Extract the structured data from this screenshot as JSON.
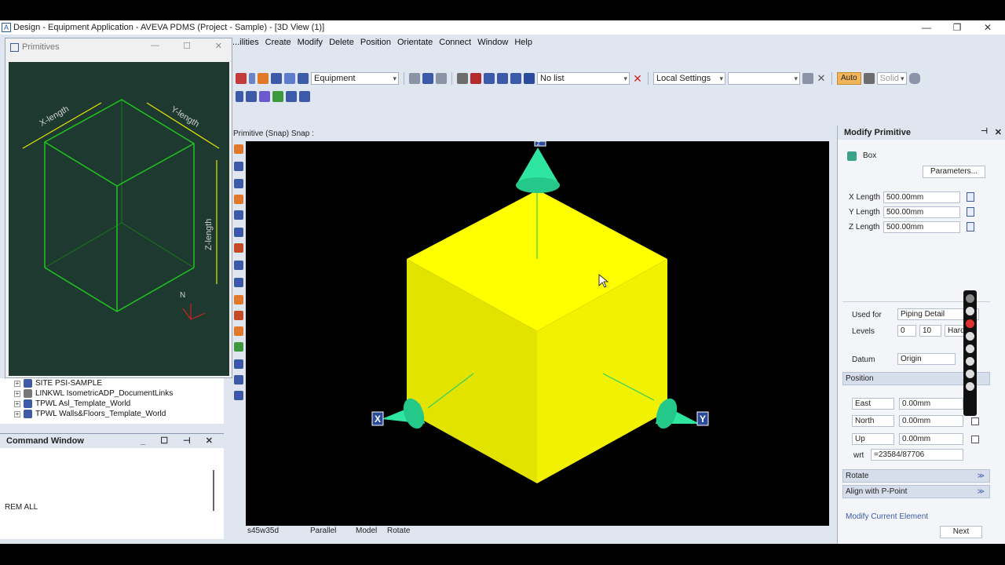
{
  "window": {
    "title": "Design - Equipment Application - AVEVA PDMS (Project - Sample) - [3D View (1)]",
    "minimize": "—",
    "restore": "❐",
    "close": "✕"
  },
  "menu": [
    "...ilities",
    "Create",
    "Modify",
    "Delete",
    "Position",
    "Orientate",
    "Connect",
    "Window",
    "Help"
  ],
  "toolbar": {
    "application_combo": "Equipment",
    "list_combo": "No list",
    "settings_combo": "Local Settings",
    "blank_combo": "",
    "auto_label": "Auto",
    "solid_label": "Solid"
  },
  "primitives_window": {
    "title": "Primitives",
    "x_label": "X-length",
    "y_label": "Y-length",
    "z_label": "Z-length",
    "north_label": "N"
  },
  "tree": {
    "items": [
      "SITE PSI-SAMPLE",
      "LINKWL IsometricADP_DocumentLinks",
      "TPWL Asl_Template_World",
      "TPWL Walls&Floors_Template_World"
    ]
  },
  "command_window": {
    "title": "Command Window",
    "text": "REM ALL"
  },
  "viewport": {
    "label": "Primitive (Snap) Snap :",
    "axis_x": "X",
    "axis_y": "Y",
    "axis_z": "Z",
    "status": {
      "view": "s45w35d",
      "projection": "Parallel",
      "mode": "Model",
      "action": "Rotate"
    }
  },
  "modify_panel": {
    "title": "Modify Primitive",
    "primitive_type": "Box",
    "parameters_button": "Parameters...",
    "x_length_label": "X Length",
    "x_length_value": "500.00mm",
    "y_length_label": "Y Length",
    "y_length_value": "500.00mm",
    "z_length_label": "Z Length",
    "z_length_value": "500.00mm",
    "used_for_label": "Used for",
    "used_for_value": "Piping Detail",
    "levels_label": "Levels",
    "level_min": "0",
    "level_max": "10",
    "level_type": "Hard",
    "datum_label": "Datum",
    "datum_value": "Origin",
    "position_section": "Position",
    "east_label": "East",
    "east_value": "0.00mm",
    "north_label": "North",
    "north_value": "0.00mm",
    "up_label": "Up",
    "up_value": "0.00mm",
    "wrt_label": "wrt",
    "wrt_value": "=23584/87706",
    "rotate_section": "Rotate",
    "align_section": "Align with P-Point",
    "modify_current_link": "Modify Current Element",
    "next_button": "Next"
  },
  "colors": {
    "box": "#ffff00",
    "box_left": "#e2e200",
    "box_right": "#f0f000",
    "cones": "#2ee6a0",
    "primitive_bg": "#1e3a30",
    "wire": "#1fc41f"
  }
}
